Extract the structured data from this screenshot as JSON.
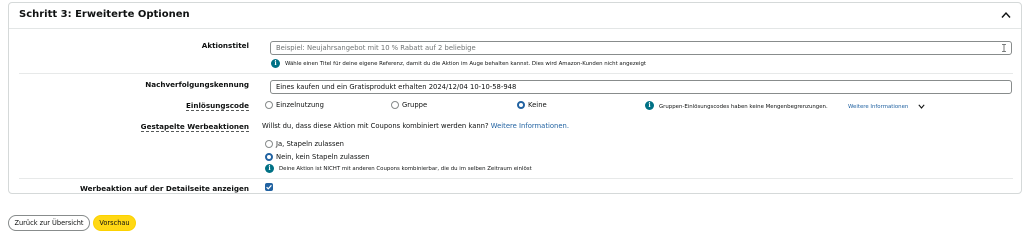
{
  "section": {
    "title": "Schritt 3: Erweiterte Optionen"
  },
  "promo_title": {
    "label": "Aktionstitel",
    "placeholder": "Beispiel: Neujahrsangebot mit 10 % Rabatt auf 2 beliebige",
    "hint": "Wähle einen Titel für deine eigene Referenz, damit du die Aktion im Auge behalten kannst. Dies wird Amazon-Kunden nicht angezeigt"
  },
  "tracking_id": {
    "label": "Nachverfolgungskennung",
    "value": "Eines kaufen und ein Gratisprodukt erhalten 2024/12/04 10-10-58-948"
  },
  "redemption_code": {
    "label": "Einlösungscode",
    "options": [
      "Einzelnutzung",
      "Gruppe",
      "Keine"
    ],
    "selected": "Keine",
    "hint": "Gruppen-Einlösungscodes haben keine Mengenbegrenzungen.",
    "more_link": "Weitere Informationen"
  },
  "stacked_promos": {
    "label": "Gestapelte Werbeaktionen",
    "question": "Willst du, dass diese Aktion mit Coupons kombiniert werden kann?",
    "more_link": "Weitere Informationen.",
    "options": [
      "Ja, Stapeln zulassen",
      "Nein, kein Stapeln zulassen"
    ],
    "selected": "Nein, kein Stapeln zulassen",
    "hint": "Deine Aktion ist NICHT mit anderen Coupons kombinierbar, die du im selben Zeitraum einlöst"
  },
  "detail_page": {
    "label": "Werbeaktion auf der Detailseite anzeigen",
    "checked": true
  },
  "footer": {
    "back_label": "Zurück zur Übersicht",
    "preview_label": "Vorschau"
  },
  "colors": {
    "accent": "#2162a1",
    "info": "#007185",
    "primary_button": "#ffd814"
  }
}
